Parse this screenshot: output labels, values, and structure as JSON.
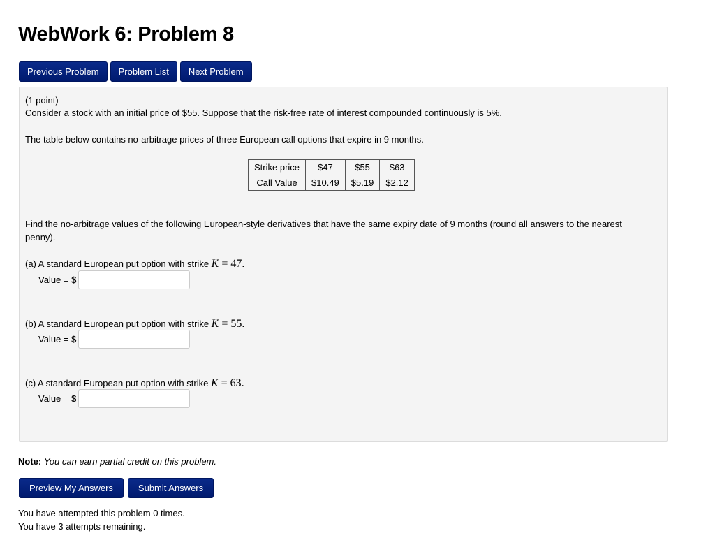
{
  "header": {
    "title": "WebWork 6: Problem 8"
  },
  "nav": {
    "previous": "Previous Problem",
    "list": "Problem List",
    "next": "Next Problem"
  },
  "problem": {
    "points": "(1 point)",
    "intro": "Consider a stock with an initial price of $55. Suppose that the risk-free rate of interest compounded continuously is 5%.",
    "table_intro": "The table below contains no-arbitrage prices of three European call options that expire in 9 months.",
    "table": {
      "rows": [
        [
          "Strike price",
          "$47",
          "$55",
          "$63"
        ],
        [
          "Call Value",
          "$10.49",
          "$5.19",
          "$2.12"
        ]
      ]
    },
    "instructions_1": "Find the no-arbitrage values of the following European-style derivatives that have the same expiry date of 9 months (round all answers to the nearest",
    "instructions_2": "penny).",
    "parts": [
      {
        "label": "(a) A standard European put option with strike",
        "var": "K",
        "eq": " = 47.",
        "value_label": "Value = $",
        "value": ""
      },
      {
        "label": "(b) A standard European put option with strike",
        "var": "K",
        "eq": " = 55.",
        "value_label": "Value = $",
        "value": ""
      },
      {
        "label": "(c) A standard European put option with strike",
        "var": "K",
        "eq": " = 63.",
        "value_label": "Value = $",
        "value": ""
      }
    ]
  },
  "note": {
    "label": "Note:",
    "text": "You can earn partial credit on this problem."
  },
  "actions": {
    "preview": "Preview My Answers",
    "submit": "Submit Answers"
  },
  "status": {
    "attempted": "You have attempted this problem 0 times.",
    "remaining": "You have 3 attempts remaining."
  }
}
